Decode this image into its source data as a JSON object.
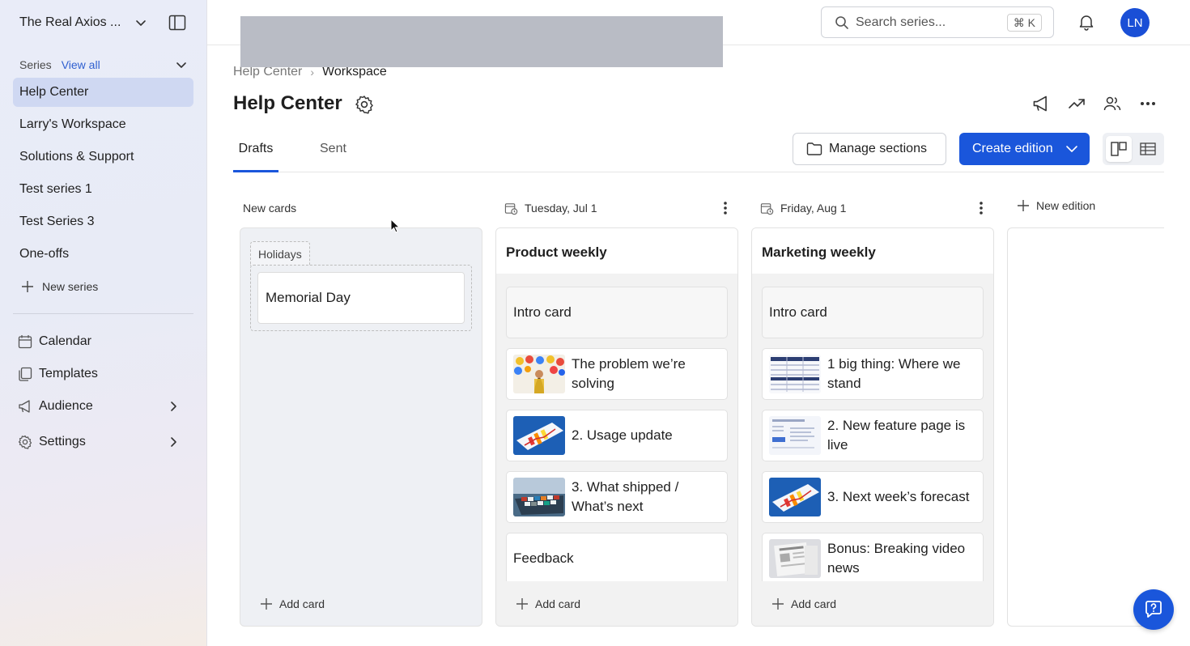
{
  "sidebar": {
    "workspace_name": "The Real Axios ...",
    "series_label": "Series",
    "view_all": "View all",
    "series_items": [
      {
        "label": "Help Center",
        "active": true
      },
      {
        "label": "Larry's Workspace"
      },
      {
        "label": "Solutions & Support"
      },
      {
        "label": "Test series 1"
      },
      {
        "label": "Test Series 3"
      },
      {
        "label": "One-offs"
      }
    ],
    "new_series": "New series",
    "tools": [
      {
        "label": "Calendar",
        "icon": "calendar-icon"
      },
      {
        "label": "Templates",
        "icon": "templates-icon"
      },
      {
        "label": "Audience",
        "icon": "megaphone-icon",
        "has_submenu": true
      },
      {
        "label": "Settings",
        "icon": "gear-icon",
        "has_submenu": true
      }
    ]
  },
  "topbar": {
    "search_placeholder": "Search series...",
    "shortcut": "⌘ K",
    "avatar_initials": "LN"
  },
  "breadcrumb": {
    "parent": "Help Center",
    "current": "Workspace"
  },
  "page": {
    "title": "Help Center",
    "tabs": [
      {
        "label": "Drafts",
        "active": true
      },
      {
        "label": "Sent"
      }
    ],
    "manage_sections": "Manage sections",
    "create_edition": "Create edition"
  },
  "board": {
    "new_cards": {
      "header": "New cards",
      "group_label": "Holidays",
      "cards": [
        "Memorial Day"
      ],
      "add_card": "Add card"
    },
    "editions": [
      {
        "date": "Tuesday, Jul 1",
        "title": "Product weekly",
        "cards": [
          {
            "text": "Intro card",
            "thumb": null
          },
          {
            "text": "The problem we’re solving",
            "thumb": "emoji-collage"
          },
          {
            "text": "2. Usage update",
            "thumb": "bar-chart"
          },
          {
            "text": "3. What shipped / What’s next",
            "thumb": "cargo-ship"
          },
          {
            "text": "Feedback",
            "thumb": null
          }
        ],
        "add_card": "Add card"
      },
      {
        "date": "Friday, Aug 1",
        "title": "Marketing weekly",
        "cards": [
          {
            "text": "Intro card",
            "thumb": null
          },
          {
            "text": "1 big thing: Where we stand",
            "thumb": "table-sheet"
          },
          {
            "text": "2. New feature page is live",
            "thumb": "web-page"
          },
          {
            "text": "3. Next week’s forecast",
            "thumb": "bar-chart"
          },
          {
            "text": "Bonus: Breaking video news",
            "thumb": "newspaper"
          }
        ],
        "add_card": "Add card"
      }
    ],
    "new_edition": "New edition"
  },
  "colors": {
    "accent": "#1a56db",
    "sidebar_active": "#cfd8f2",
    "link": "#2f5fd0"
  }
}
